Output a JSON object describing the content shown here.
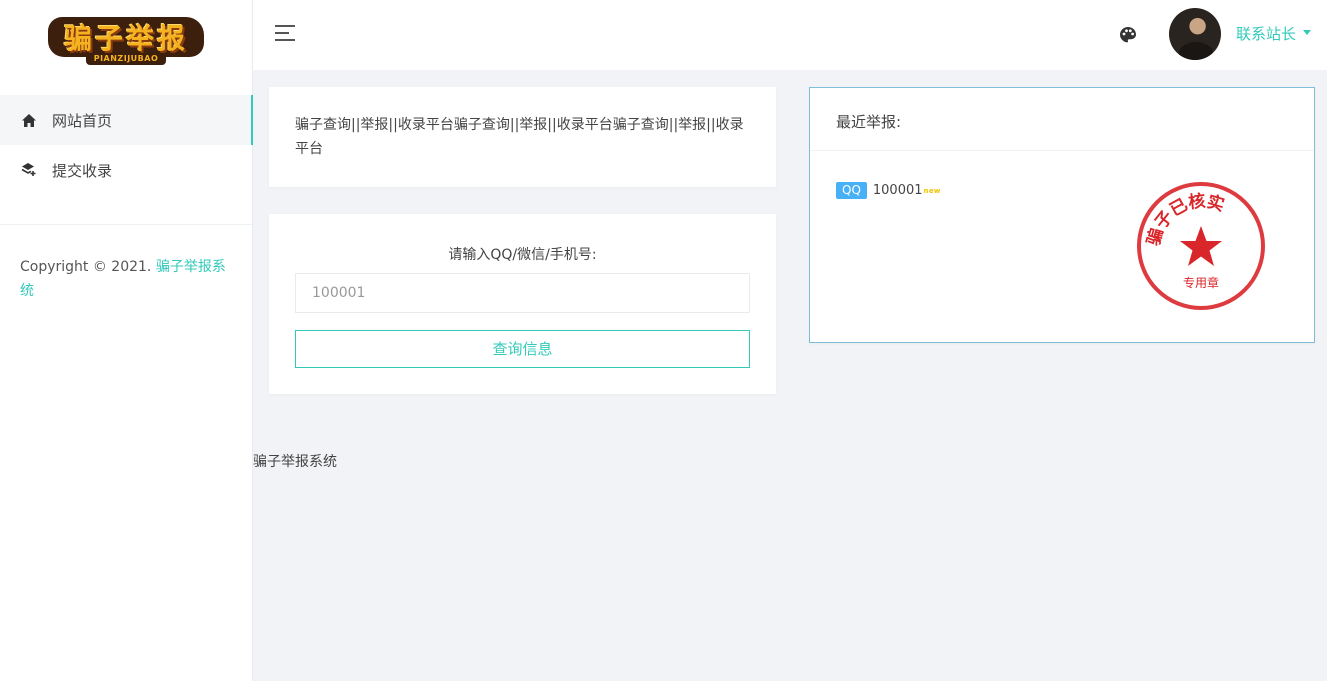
{
  "logo": {
    "text": "骗子举报",
    "subtext": "PIANZIJUBAO"
  },
  "sidebar": {
    "items": [
      {
        "label": "网站首页",
        "icon": "home-icon",
        "active": true
      },
      {
        "label": "提交收录",
        "icon": "layers-icon",
        "active": false
      }
    ],
    "copyright_prefix": "Copyright © 2021. ",
    "copyright_link": "骗子举报系统"
  },
  "header": {
    "user_name": "联系站长",
    "accent_color": "#33cabb"
  },
  "intro": {
    "text": "骗子查询||举报||收录平台骗子查询||举报||收录平台骗子查询||举报||收录平台"
  },
  "search": {
    "label": "请输入QQ/微信/手机号:",
    "placeholder": "100001",
    "button_label": "查询信息"
  },
  "recent": {
    "title": "最近举报:",
    "items": [
      {
        "type": "QQ",
        "number": "100001",
        "badge": "new"
      }
    ],
    "stamp": {
      "top_text": "骗子已核实",
      "bottom_text": "专用章",
      "color": "#d9262a"
    }
  },
  "footer": {
    "text": "骗子举报系统"
  }
}
